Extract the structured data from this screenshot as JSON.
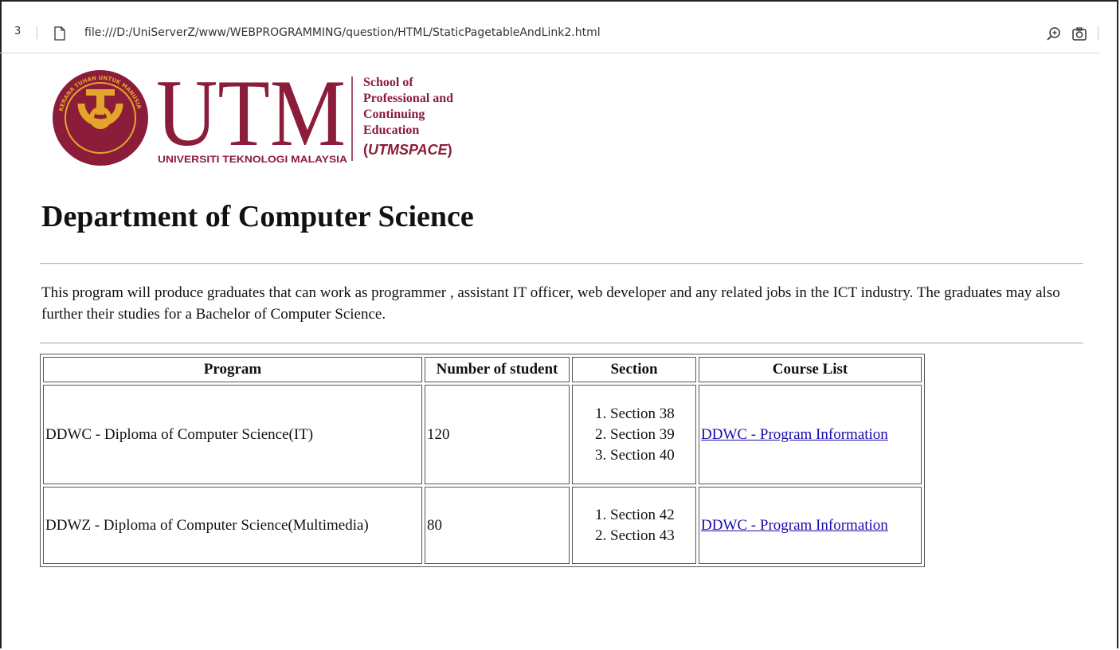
{
  "browser": {
    "tab_stub": "3",
    "url": "file:///D:/UniServerZ/www/WEBPROGRAMMING/question/HTML/StaticPagetableAndLink2.html",
    "icons": [
      "page-icon",
      "zoom-icon",
      "camera-icon"
    ]
  },
  "logo": {
    "brand": "UTM",
    "ring_text": "UNIVERSITI TEKNOLOGI MALAYSIA",
    "seal_motto": "KERANA TUHAN UNTUK MANUSIA",
    "school_line1": "School of",
    "school_line2": "Professional and",
    "school_line3": "Continuing",
    "school_line4": "Education",
    "school_open": "(",
    "school_abbr": "UTMSPACE",
    "school_close": ")",
    "colors": {
      "maroon": "#8b1c3a",
      "gold": "#e3a52b"
    }
  },
  "page": {
    "heading": "Department of Computer Science",
    "description": "This program will produce graduates that can work as programmer , assistant IT officer, web developer and any related jobs in the ICT industry. The graduates may also further their studies for a Bachelor of Computer Science."
  },
  "table": {
    "headers": [
      "Program",
      "Number of student",
      "Section",
      "Course List"
    ],
    "rows": [
      {
        "program": "DDWC - Diploma of Computer Science(IT)",
        "students": "120",
        "sections": [
          "Section 38",
          "Section 39",
          "Section 40"
        ],
        "link": "DDWC - Program Information"
      },
      {
        "program": "DDWZ - Diploma of Computer Science(Multimedia)",
        "students": "80",
        "sections": [
          "Section 42",
          "Section 43"
        ],
        "link": "DDWC - Program Information"
      }
    ]
  }
}
